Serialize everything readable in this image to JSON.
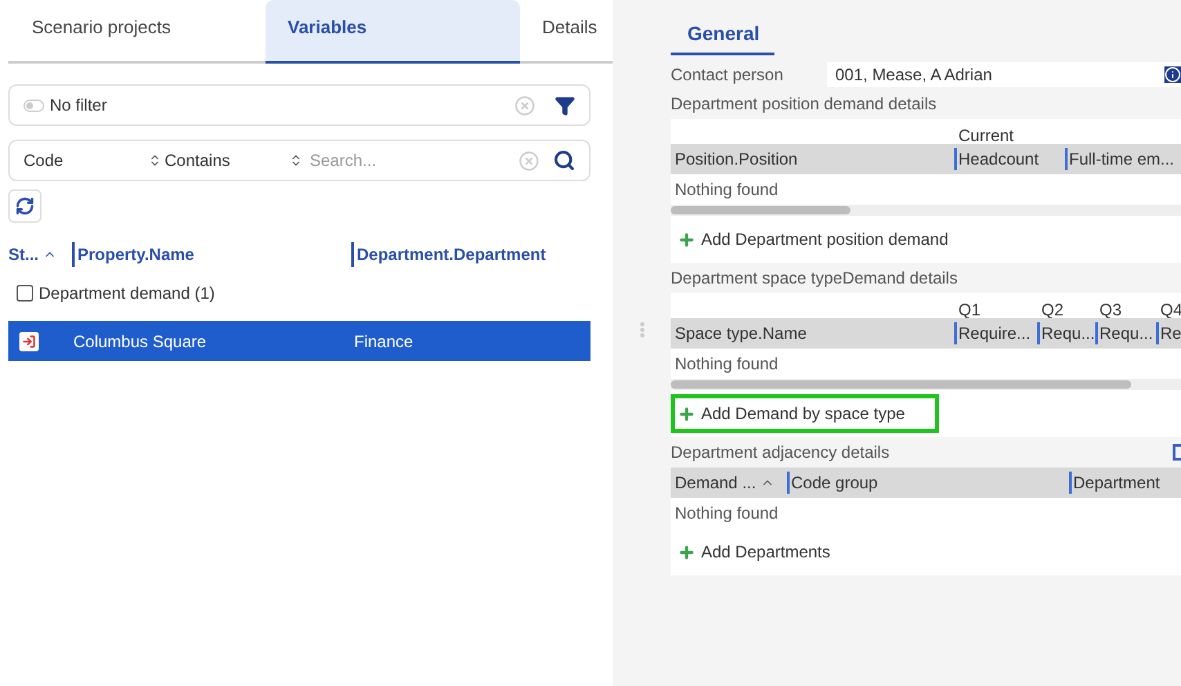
{
  "tabs": [
    {
      "label": "Scenario projects",
      "selected": false
    },
    {
      "label": "Variables",
      "selected": true
    },
    {
      "label": "Details",
      "selected": false
    }
  ],
  "filter": {
    "toggle_on": false,
    "label": "No filter"
  },
  "search": {
    "field": "Code",
    "operator": "Contains",
    "placeholder": "Search..."
  },
  "list": {
    "columns": [
      "St...",
      "Property.Name",
      "Department.Department"
    ],
    "group": {
      "label": "Department demand (1)",
      "checked": false
    },
    "rows": [
      {
        "property": "Columbus Square",
        "department": "Finance",
        "selected": true
      }
    ]
  },
  "detail": {
    "tab": "General",
    "contact": {
      "label": "Contact person",
      "value": "001, Mease, A Adrian"
    },
    "sections": [
      {
        "title": "Department position demand details",
        "columns": [
          {
            "label": "Position.Position"
          },
          {
            "label": "Headcount",
            "group": "Current"
          },
          {
            "label": "Full-time em..."
          }
        ],
        "empty": "Nothing found",
        "scroll": true,
        "add": "Add Department position demand",
        "highlighted": false
      },
      {
        "title": "Department space typeDemand details",
        "columns": [
          {
            "label": "Space type.Name"
          },
          {
            "label": "Require...",
            "group": "Q1"
          },
          {
            "label": "Requ...",
            "group": "Q2"
          },
          {
            "label": "Requ...",
            "group": "Q3"
          },
          {
            "label": "Re",
            "group": "Q4"
          }
        ],
        "empty": "Nothing found",
        "scroll": true,
        "add": "Add Demand by space type",
        "highlighted": true
      },
      {
        "title": "Department adjacency details",
        "columns": [
          {
            "label": "Demand ..."
          },
          {
            "label": "Code group"
          },
          {
            "label": "Department"
          }
        ],
        "empty": "Nothing found",
        "scroll": false,
        "add": "Add Departments",
        "highlighted": false
      }
    ]
  }
}
